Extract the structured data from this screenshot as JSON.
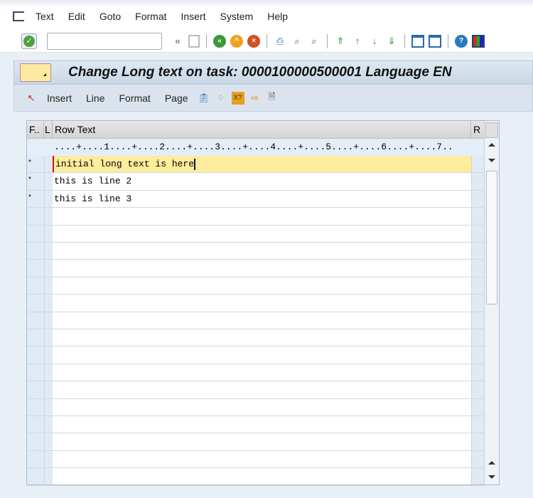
{
  "menu": [
    "Text",
    "Edit",
    "Goto",
    "Format",
    "Insert",
    "System",
    "Help"
  ],
  "command_field": {
    "value": ""
  },
  "title": "Change Long text on task: 0000100000500001 Language EN",
  "app_toolbar": [
    "Insert",
    "Line",
    "Format",
    "Page"
  ],
  "grid": {
    "headers": {
      "f": "F..",
      "l": "L",
      "text": "Row Text",
      "r": "R"
    },
    "ruler": "....+....1....+....2....+....3....+....4....+....5....+....6....+....7..",
    "rows": [
      {
        "format": "*",
        "text": "initial long text is here"
      },
      {
        "format": "*",
        "text": "this is line 2"
      },
      {
        "format": "*",
        "text": "this is line 3"
      }
    ]
  }
}
